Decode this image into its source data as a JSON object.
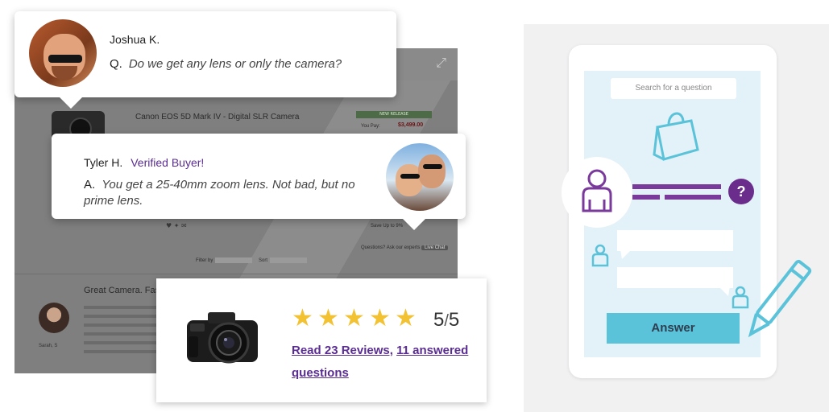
{
  "background_page": {
    "product_title": "Canon EOS 5D Mark IV - Digital SLR Camera",
    "release_badge": "NEW RELEASE",
    "you_pay_label": "You Pay:",
    "price": "$3,499.00",
    "sign_up_text": "Save Up to 9%",
    "questions_text": "Questions? Ask our experts",
    "questions_chip": "Live Chat",
    "filter_label": "Filter by",
    "sort_label": "Sort",
    "review_title": "Great Camera. Fas",
    "reviewer_name": "Sarah, S"
  },
  "question_card": {
    "name": "Joshua K.",
    "prefix": "Q.",
    "text": "Do we get any lens or only the camera?"
  },
  "answer_card": {
    "name": "Tyler H.",
    "badge": "Verified Buyer!",
    "prefix": "A.",
    "text": "You get a 25-40mm zoom lens.  Not bad, but no prime lens."
  },
  "review_card": {
    "stars": 5,
    "rating_value": "5",
    "rating_sep": "/",
    "rating_max": "5",
    "link_reviews": "Read 23 Reviews,",
    "link_questions": "11 answered questions"
  },
  "illustration": {
    "search_placeholder": "Search for a question",
    "question_mark": "?",
    "answer_button": "Answer",
    "colors": {
      "purple": "#7a3a9b",
      "teal": "#5bc3d9",
      "screen": "#e3f1f8"
    }
  }
}
